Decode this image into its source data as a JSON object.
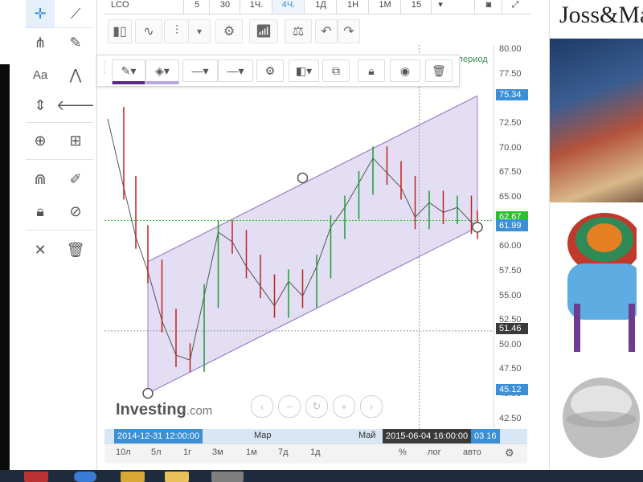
{
  "symbol": "LCO",
  "intervals": [
    "5",
    "30",
    "1Ч.",
    "4Ч.",
    "1Д",
    "1Н",
    "1М",
    "15"
  ],
  "active_interval": "4Ч.",
  "period_label": "период",
  "watermark": {
    "brand": "Investing",
    "suffix": ".com"
  },
  "price_ticks": [
    "80.00",
    "77.50",
    "75.00",
    "72.50",
    "70.00",
    "67.50",
    "65.00",
    "62.50",
    "60.00",
    "57.50",
    "55.00",
    "52.50",
    "50.00",
    "47.50",
    "45.00",
    "42.50"
  ],
  "price_badges": {
    "upper_channel": "75.34",
    "last_price_green": "62.67",
    "last_price": "61.99",
    "crosshair": "51.46",
    "lower_channel": "45.12"
  },
  "time_axis": {
    "start_badge": "2014-12-31 12:00:00",
    "label_mar": "Мар",
    "label_may": "Май",
    "cursor_badge": "2015-06-04 16:00:00",
    "end_badge": "03 16"
  },
  "ranges": [
    "10л",
    "5л",
    "1г",
    "3м",
    "1м",
    "7д",
    "1д"
  ],
  "range_options": [
    "%",
    "лог",
    "авто"
  ],
  "ad": {
    "logo": "Joss&Main"
  },
  "colors": {
    "accent": "#3b8fd5",
    "channel_fill": "#d9d3f0",
    "channel_line": "#9a82c9",
    "up": "#1f9a2e",
    "down": "#c02020"
  },
  "chart_data": {
    "type": "line",
    "title": "",
    "xlabel": "",
    "ylabel": "",
    "ylim": [
      41.5,
      80.5
    ],
    "x": [
      "2014-12-31",
      "2015-01-08",
      "2015-01-14",
      "2015-01-20",
      "2015-01-27",
      "2015-02-03",
      "2015-02-10",
      "2015-02-17",
      "2015-02-24",
      "2015-03-03",
      "2015-03-10",
      "2015-03-17",
      "2015-03-24",
      "2015-03-31",
      "2015-04-07",
      "2015-04-14",
      "2015-04-21",
      "2015-04-28",
      "2015-05-05",
      "2015-05-12",
      "2015-05-19",
      "2015-05-26",
      "2015-06-02",
      "2015-06-09",
      "2015-06-16",
      "2015-06-23",
      "2015-06-30",
      "2015-07-03"
    ],
    "series": [
      {
        "values": [
          73.0,
          66.0,
          61.0,
          57.5,
          52.5,
          49.0,
          48.5,
          55.0,
          61.5,
          60.5,
          58.0,
          56.0,
          54.0,
          56.5,
          55.0,
          58.0,
          62.0,
          64.0,
          66.5,
          69.0,
          67.5,
          66.0,
          63.0,
          64.5,
          63.5,
          64.0,
          62.5,
          61.99
        ]
      }
    ],
    "channel": {
      "upper": [
        [
          "2015-01-20",
          58.5
        ],
        [
          "2015-07-03",
          75.34
        ]
      ],
      "lower": [
        [
          "2015-01-20",
          45.12
        ],
        [
          "2015-07-03",
          61.99
        ]
      ]
    }
  }
}
